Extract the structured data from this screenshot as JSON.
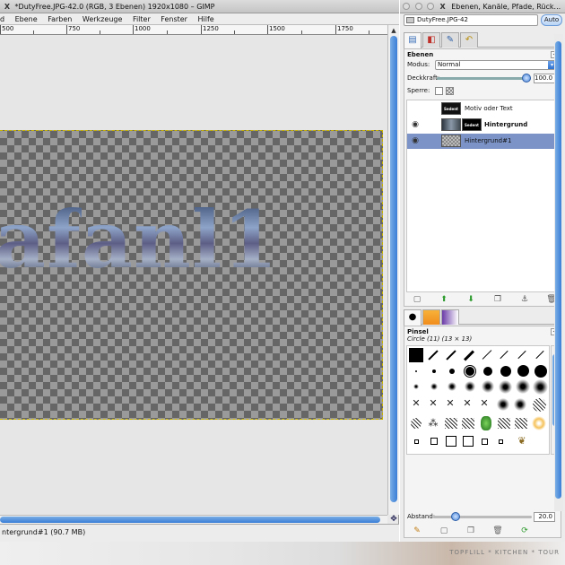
{
  "main_window": {
    "title": "*DutyFree.JPG-42.0 (RGB, 3 Ebenen) 1920x1080 – GIMP",
    "menu": [
      "d",
      "Ebene",
      "Farben",
      "Werkzeuge",
      "Filter",
      "Fenster",
      "Hilfe"
    ],
    "ruler_labels": [
      "500",
      "750",
      "1000",
      "1250",
      "1500",
      "1750"
    ],
    "art_text": [
      "a",
      "f",
      "a",
      "n",
      "l",
      "1"
    ],
    "status_text": "ntergrund#1 (90.7 MB)"
  },
  "dock_window": {
    "title": "Ebenen, Kanäle, Pfade, Rück...",
    "image_select": "DutyFree.JPG-42",
    "auto_label": "Auto",
    "layers": {
      "heading": "Ebenen",
      "mode_label": "Modus:",
      "mode_value": "Normal",
      "opacity_label": "Deckkraft:",
      "opacity_value": "100.0",
      "opacity_fraction": 1.0,
      "lock_label": "Sperre:",
      "thumb_text": "Sedent",
      "list": [
        {
          "name": "Motiv oder Text",
          "visible": false,
          "bold": false,
          "selected": false
        },
        {
          "name": "Hintergrund",
          "visible": true,
          "bold": true,
          "selected": false
        },
        {
          "name": "Hintergrund#1",
          "visible": true,
          "bold": false,
          "selected": true
        }
      ]
    },
    "brushes": {
      "heading": "Pinsel",
      "current": "Circle (11) (13 × 13)",
      "spacing_label": "Abstand:",
      "spacing_value": "20.0",
      "spacing_fraction": 0.2
    }
  },
  "watermark": "TOPFLILL * KITCHEN * TOUR",
  "colors": {
    "accent": "#3a7ed6",
    "selected_row": "#7b93c6"
  }
}
